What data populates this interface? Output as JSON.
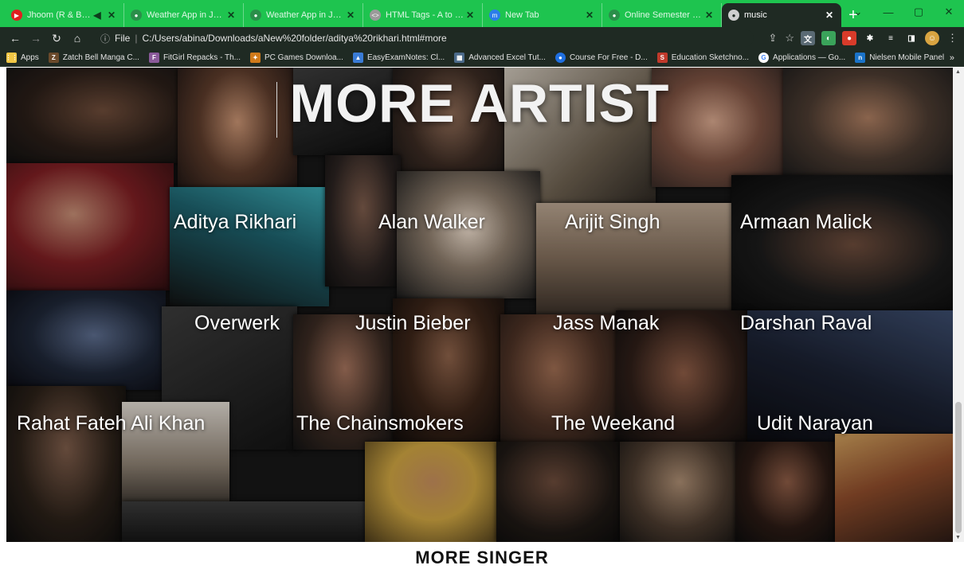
{
  "browser": {
    "tabs": [
      {
        "title": "Jhoom (R & B Mix)",
        "favicon": "youtube-icon",
        "color": "#e02020"
      },
      {
        "title": "Weather App in JavaScript",
        "favicon": "globe-icon",
        "color": "#2a8f4a"
      },
      {
        "title": "Weather App in JavaScript",
        "favicon": "globe-icon",
        "color": "#2a8f4a"
      },
      {
        "title": "HTML Tags - A to Z List",
        "favicon": "code-icon",
        "color": "#9a9a9a"
      },
      {
        "title": "New Tab",
        "favicon": "m-icon",
        "color": "#2b7de9"
      },
      {
        "title": "Online Semester Exam",
        "favicon": "globe-icon",
        "color": "#2a8f4a"
      },
      {
        "title": "music",
        "favicon": "globe-icon",
        "color": "#cfcfcf",
        "active": true
      }
    ],
    "new_tab_label": "+",
    "address": {
      "scheme_label": "File",
      "url": "C:/Users/abina/Downloads/aNew%20folder/aditya%20rikhari.html#more"
    },
    "bookmarks": [
      {
        "label": "Apps",
        "icon": "apps-grid-icon",
        "color": "#f2c744"
      },
      {
        "label": "Zatch Bell Manga C...",
        "icon": "manga-icon",
        "color": "#6b4a2b"
      },
      {
        "label": "FitGirl Repacks - Th...",
        "icon": "fitgirl-icon",
        "color": "#8a5a9a"
      },
      {
        "label": "PC Games Downloa...",
        "icon": "game-icon",
        "color": "#d07a1a"
      },
      {
        "label": "EasyExamNotes: Cl...",
        "icon": "mountain-icon",
        "color": "#3a7bd5"
      },
      {
        "label": "Advanced Excel Tut...",
        "icon": "excel-icon",
        "color": "#4b6a8a"
      },
      {
        "label": "Course For Free - D...",
        "icon": "course-icon",
        "color": "#1f6fe0"
      },
      {
        "label": "Education Sketchno...",
        "icon": "s-icon",
        "color": "#c0392b"
      },
      {
        "label": "Applications — Go...",
        "icon": "google-icon",
        "color": "#4285f4"
      },
      {
        "label": "Nielsen Mobile Panel",
        "icon": "n-icon",
        "color": "#1a73c9"
      }
    ],
    "bookmarks_overflow": "»"
  },
  "page": {
    "heading": "MORE ARTIST",
    "artists": [
      "Aditya Rikhari",
      "Alan Walker",
      "Arijit Singh",
      "Armaan Malick",
      "Overwerk",
      "Justin Bieber",
      "Jass Manak",
      "Darshan Raval",
      "Rahat Fateh Ali Khan",
      "The Chainsmokers",
      "The Weekand",
      "Udit Narayan"
    ],
    "footer_heading": "MORE SINGER"
  }
}
